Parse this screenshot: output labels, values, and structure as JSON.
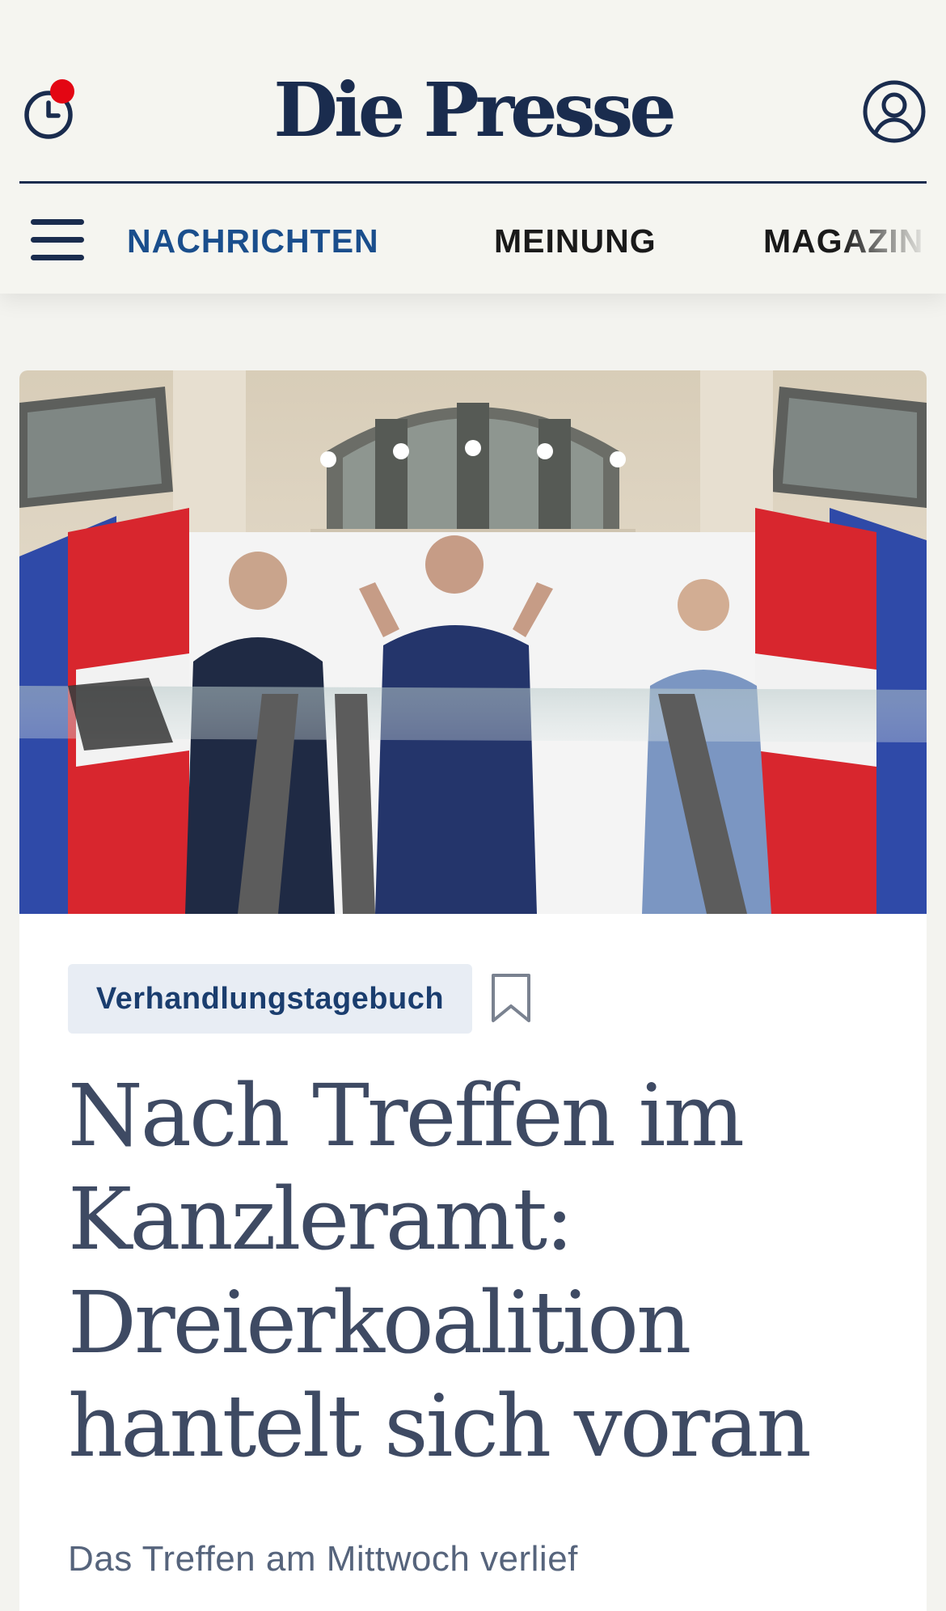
{
  "header": {
    "logo": "Die Presse",
    "history_icon": "history-clock-icon",
    "user_icon": "user-account-icon",
    "menu_icon": "hamburger-menu-icon",
    "notification_color": "#e30613",
    "brand_color": "#1a2c4e",
    "nav": [
      {
        "label": "NACHRICHTEN",
        "active": true
      },
      {
        "label": "MEINUNG",
        "active": false
      },
      {
        "label": "MAGAZIN",
        "active": false
      }
    ]
  },
  "article": {
    "kicker": "Verhandlungstagebuch",
    "bookmark_icon": "bookmark-icon",
    "headline": "Nach Treffen im Kanzleramt: Dreierkoalition hantelt sich voran",
    "lead": "Das Treffen am Mittwoch verlief"
  }
}
